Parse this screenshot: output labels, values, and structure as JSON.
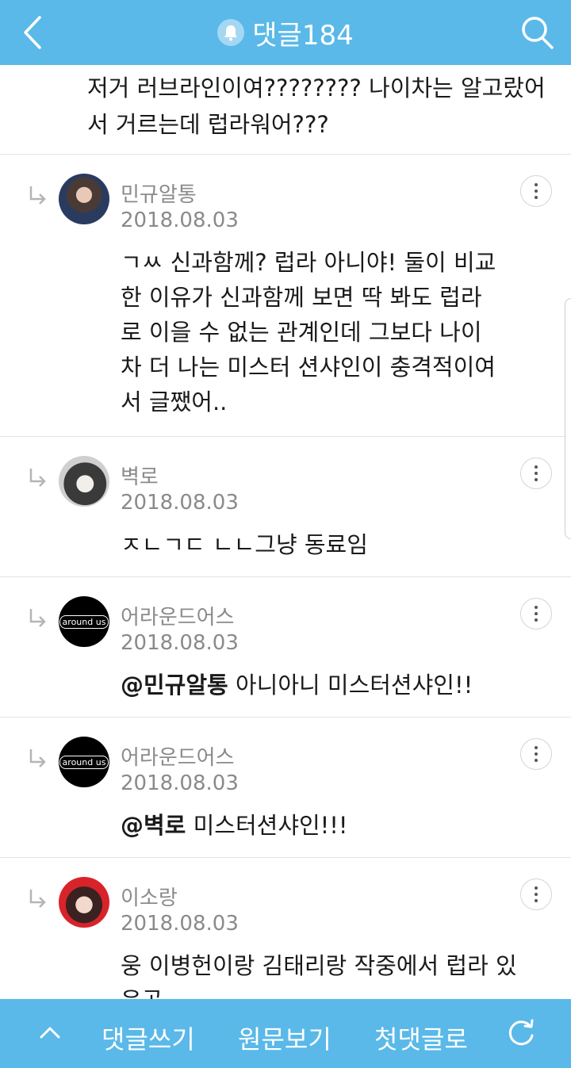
{
  "header": {
    "title": "댓글184",
    "icons": [
      "back-arrow-icon",
      "bell-icon",
      "search-icon"
    ]
  },
  "top_comment": {
    "text": "저거 러브라인이여????????  나이차는 알고랐어서 거르는데 럽라워어???"
  },
  "comments": [
    {
      "username": "민규알통",
      "date": "2018.08.03",
      "mention": "",
      "text": "ㄱㅆ 신과함께?  럽라 아니야!  둘이 비교한 이유가 신과함께 보면 딱 봐도 럽라로 이을 수 없는 관계인데 그보다 나이차 더 나는 미스터 션샤인이 충격적이여서 글쨌어.."
    },
    {
      "username": "벽로",
      "date": "2018.08.03",
      "mention": "",
      "text": "ㅈㄴㄱㄷ ㄴㄴ그냥 동료임"
    },
    {
      "username": "어라운드어스",
      "date": "2018.08.03",
      "mention": "@민규알통",
      "text": " 아니아니 미스터션샤인!!"
    },
    {
      "username": "어라운드어스",
      "date": "2018.08.03",
      "mention": "@벽로",
      "text": " 미스터션샤인!!!"
    },
    {
      "username": "이소랑",
      "date": "2018.08.03",
      "mention": "",
      "text": "웅 이병헌이랑 김태리랑 작중에서 럽라 있음공"
    }
  ],
  "avatars": {
    "around_us_logo_text": "around us"
  },
  "bottom_bar": {
    "write": "댓글쓰기",
    "original": "원문보기",
    "first": "첫댓글로"
  },
  "colors": {
    "header_bg": "#5ab9e8",
    "text": "#1a1a1a",
    "meta": "#8a8a8a"
  }
}
